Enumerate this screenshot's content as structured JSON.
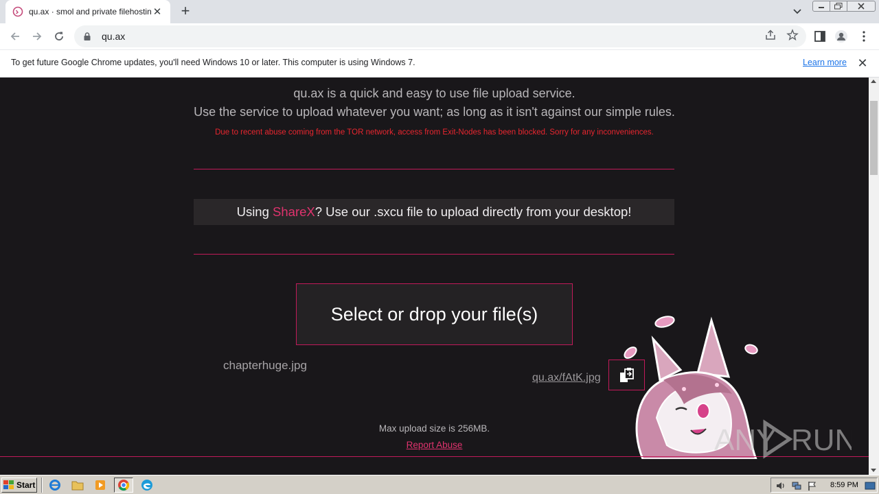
{
  "browser": {
    "tab": {
      "title": "qu.ax · smol and private filehosting"
    },
    "address": {
      "url": "qu.ax"
    },
    "infobar": {
      "message": "To get future Google Chrome updates, you'll need Windows 10 or later. This computer is using Windows 7.",
      "link": "Learn more"
    }
  },
  "page": {
    "intro_line1": "qu.ax is a quick and easy to use file upload service.",
    "intro_line2": "Use the service to upload whatever you want; as long as it isn't against our simple rules.",
    "notice": "Due to recent abuse coming from the TOR network, access from Exit-Nodes has been blocked. Sorry for any inconveniences.",
    "sharex": {
      "prefix": "Using ",
      "link": "ShareX",
      "suffix": "? Use our .sxcu file to upload directly from your desktop!"
    },
    "select_button": "Select or drop your file(s)",
    "uploaded": {
      "file_name": "chapterhuge.jpg",
      "file_url": "qu.ax/fAtK.jpg"
    },
    "max_upload": "Max upload size is 256MB.",
    "report_abuse": "Report Abuse"
  },
  "watermark": {
    "text": "RUN"
  },
  "taskbar": {
    "start_label": "Start",
    "clock": "8:59 PM"
  },
  "colors": {
    "accent": "#e0336e",
    "rule": "#c21a5a",
    "notice": "#e8262f",
    "page_bg": "#19171a"
  }
}
